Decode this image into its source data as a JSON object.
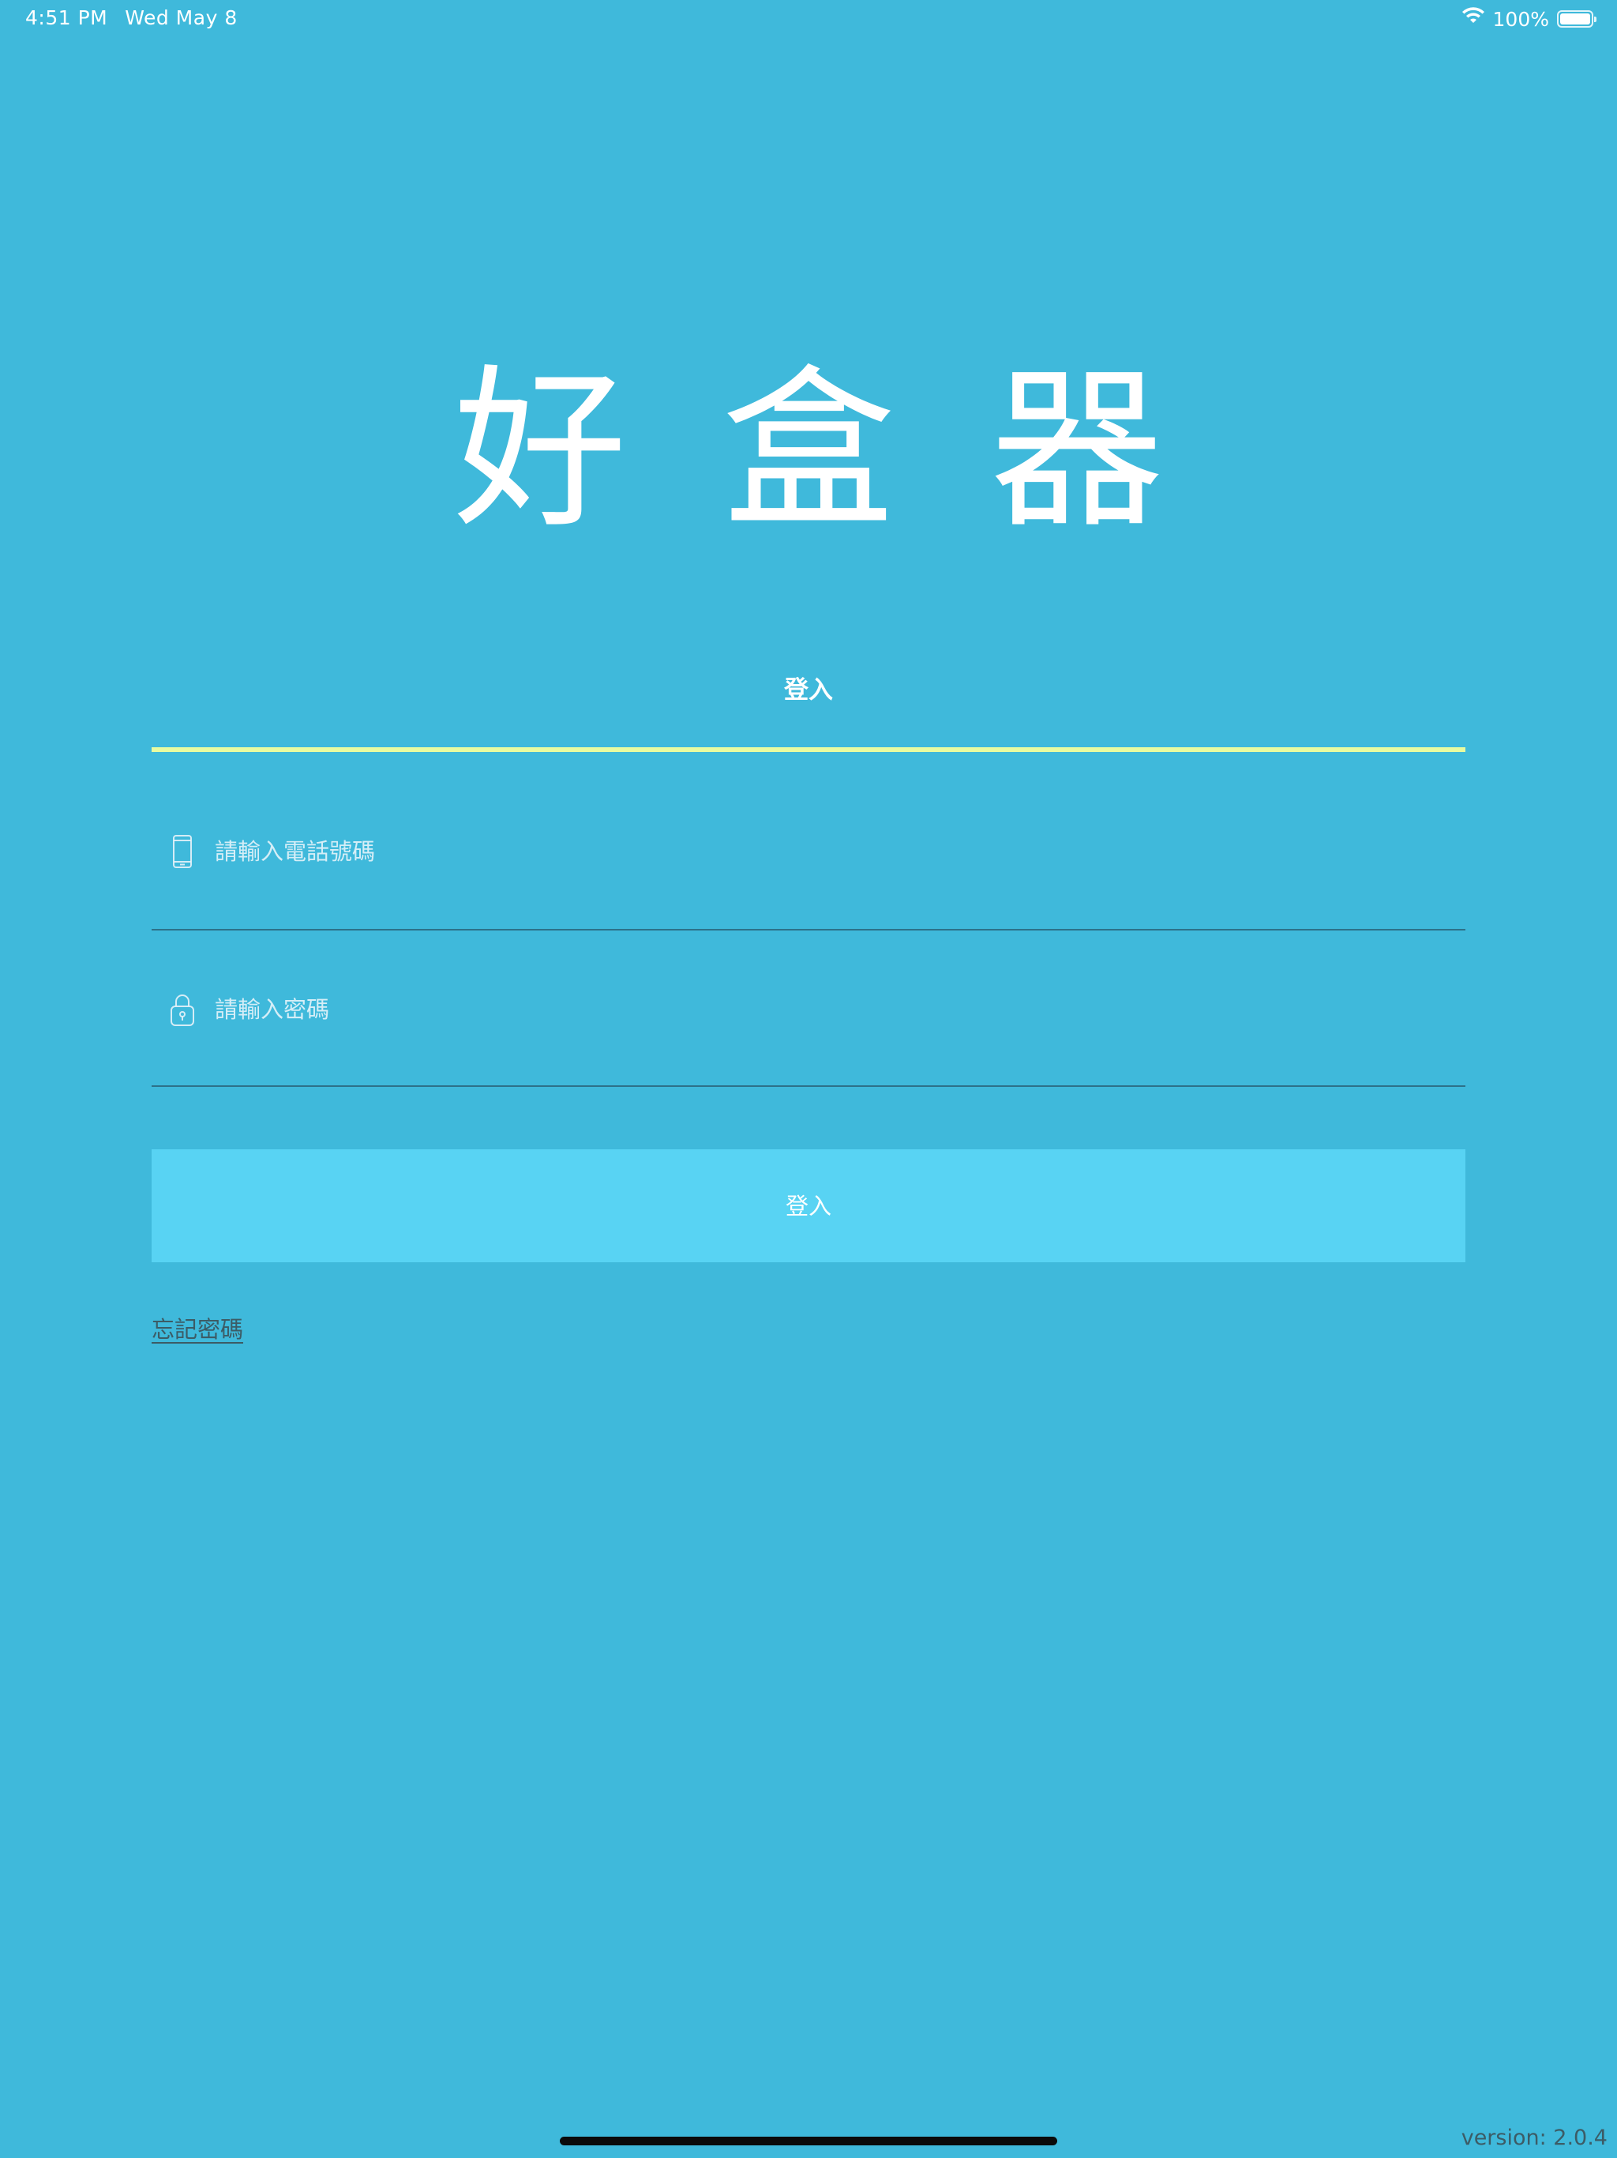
{
  "status_bar": {
    "time": "4:51 PM",
    "date": "Wed May 8",
    "battery_percent": "100%",
    "battery_level": 1.0,
    "wifi_icon": "wifi-icon",
    "battery_icon": "battery-icon"
  },
  "logo": {
    "text": "好盒器"
  },
  "tab": {
    "label": "登入",
    "indicator_color": "#e8fba0"
  },
  "form": {
    "phone": {
      "icon": "phone-icon",
      "placeholder": "請輸入電話號碼",
      "value": ""
    },
    "password": {
      "icon": "lock-icon",
      "placeholder": "請輸入密碼",
      "value": ""
    },
    "login_button_label": "登入",
    "forgot_password_label": "忘記密碼"
  },
  "footer": {
    "version": "version: 2.0.4"
  },
  "colors": {
    "background": "#3fb9db",
    "button": "#58d3f3",
    "accent": "#e8fba0",
    "link": "#3c5c66"
  }
}
